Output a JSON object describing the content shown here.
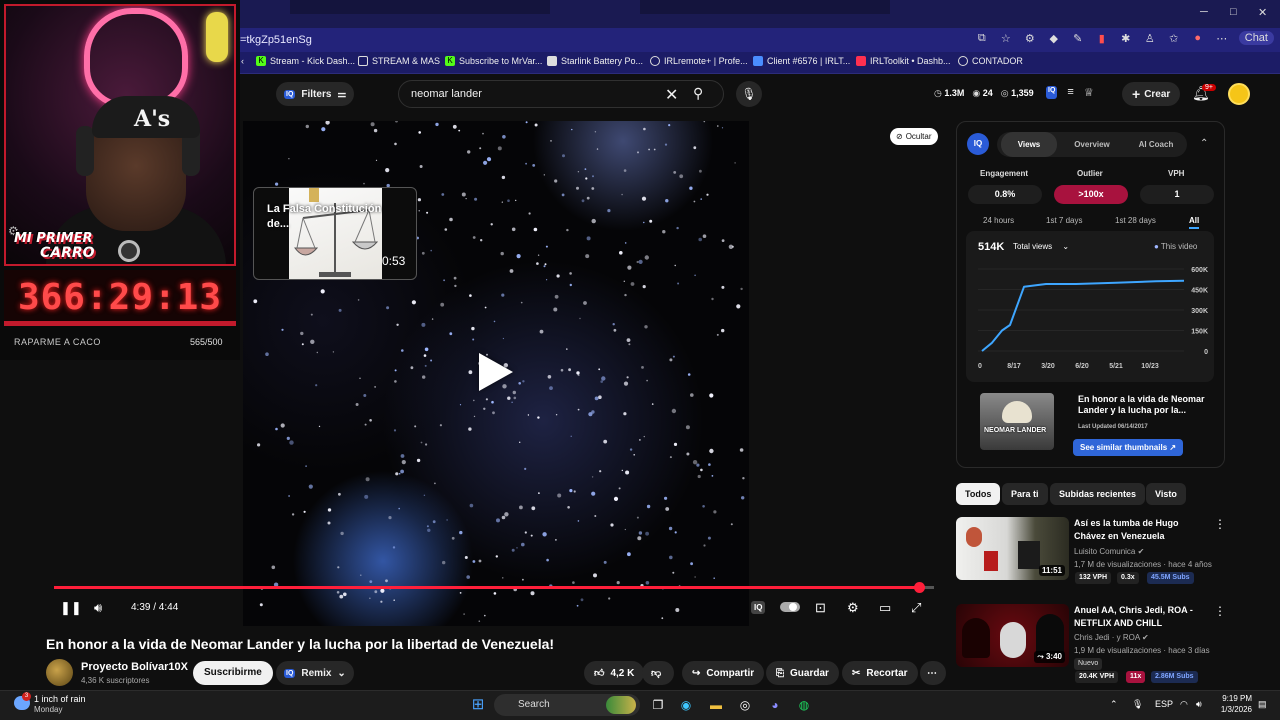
{
  "browser": {
    "address": "=tkgZp51enSg",
    "chat_label": "Chat",
    "bookmarks": [
      {
        "label": "Stream - Kick Dash...",
        "color": "#53fc18"
      },
      {
        "label": "STREAM & MAS",
        "color": "#ffffff"
      },
      {
        "label": "Subscribe to MrVar...",
        "color": "#53fc18"
      },
      {
        "label": "Starlink Battery Po...",
        "color": "#ffffff"
      },
      {
        "label": "IRLremote+ | Profe...",
        "color": "#ffffff"
      },
      {
        "label": "Client #6576 | IRLT...",
        "color": "#4a8dff"
      },
      {
        "label": "IRLToolkit • Dashb...",
        "color": "#ff3050"
      },
      {
        "label": "CONTADOR",
        "color": "#ffffff"
      }
    ]
  },
  "yt_header": {
    "filters_label": "Filters",
    "iq_label": "IQ",
    "search_value": "neomar lander",
    "stats": {
      "views": "1.3M",
      "videos": "24",
      "eye": "1,359"
    },
    "create_label": "Crear",
    "bell_badge": "9+"
  },
  "player": {
    "endcard_title": "La Falsa Constitución de...",
    "endcard_duration": "0:53",
    "hide_label": "Ocultar",
    "time": "4:39 / 4:44",
    "progress": 0.983,
    "iq_ctrl": "IQ"
  },
  "video_info": {
    "title": "En honor a la vida de Neomar Lander y la lucha por la libertad de Venezuela!",
    "channel": "Proyecto Bolívar10X",
    "subscribers": "4,36 K suscriptores",
    "subscribe_label": "Suscribirme",
    "remix_label": "Remix",
    "likes": "4,2 K",
    "share_label": "Compartir",
    "save_label": "Guardar",
    "clip_label": "Recortar"
  },
  "vidiq": {
    "logo": "IQ",
    "tabs": [
      "Views",
      "Overview",
      "AI Coach"
    ],
    "metrics": [
      {
        "label": "Engagement",
        "value": "0.8%"
      },
      {
        "label": "Outlier",
        "value": ">100x"
      },
      {
        "label": "VPH",
        "value": "1"
      }
    ],
    "ranges": [
      "24 hours",
      "1st 7 days",
      "1st 28 days",
      "All"
    ],
    "total": "514K",
    "total_select": "Total views",
    "legend": "This video",
    "related_title": "En honor a la vida de Neomar Lander y la lucha por la...",
    "related_updated": "Last Updated 06/14/2017",
    "related_thumb_text": "NEOMAR LANDER",
    "related_button": "See similar thumbnails ↗"
  },
  "chart_data": {
    "type": "line",
    "x": [
      "0",
      "8/17",
      "3/20",
      "6/20",
      "5/21",
      "10/23"
    ],
    "series": [
      {
        "name": "This video",
        "values": [
          0,
          60000,
          150000,
          190000,
          470000,
          490000,
          490000,
          500000,
          510000,
          514000
        ]
      }
    ],
    "yticks": [
      "600K",
      "450K",
      "300K",
      "150K",
      "0"
    ],
    "ylim": [
      0,
      600000
    ],
    "color": "#3ea6ff"
  },
  "chips": [
    "Todos",
    "Para ti",
    "Subidas recientes",
    "Visto"
  ],
  "recommendations": [
    {
      "title": "Así es la tumba de Hugo Chávez en Venezuela",
      "channel": "Luisito Comunica",
      "meta": "1,7 M de visualizaciones · hace 4 años",
      "duration": "11:51",
      "vph": "132 VPH",
      "mult": "0.3x",
      "subs": "45.5M Subs"
    },
    {
      "title": "Anuel AA, Chris Jedi, ROA - NETFLIX AND CHILL",
      "channel": "Chris Jedi · y ROA",
      "meta": "1,9 M de visualizaciones · hace 3 días",
      "duration": "3:40",
      "badge": "Nuevo",
      "vph": "20.4K VPH",
      "mult": "11x",
      "subs": "2.86M Subs"
    }
  ],
  "stream_overlay": {
    "banner_line1": "MI PRIMER",
    "banner_line2": "CARRO",
    "timer": "366:29:13",
    "goal_label": "RAPARME A CACO",
    "goal_value": "565/500"
  },
  "taskbar": {
    "weather_title": "1 inch of rain",
    "weather_sub": "Monday",
    "weather_badge": "3",
    "search_label": "Search",
    "lang": "ESP",
    "time": "9:19 PM",
    "date": "1/3/2026"
  }
}
